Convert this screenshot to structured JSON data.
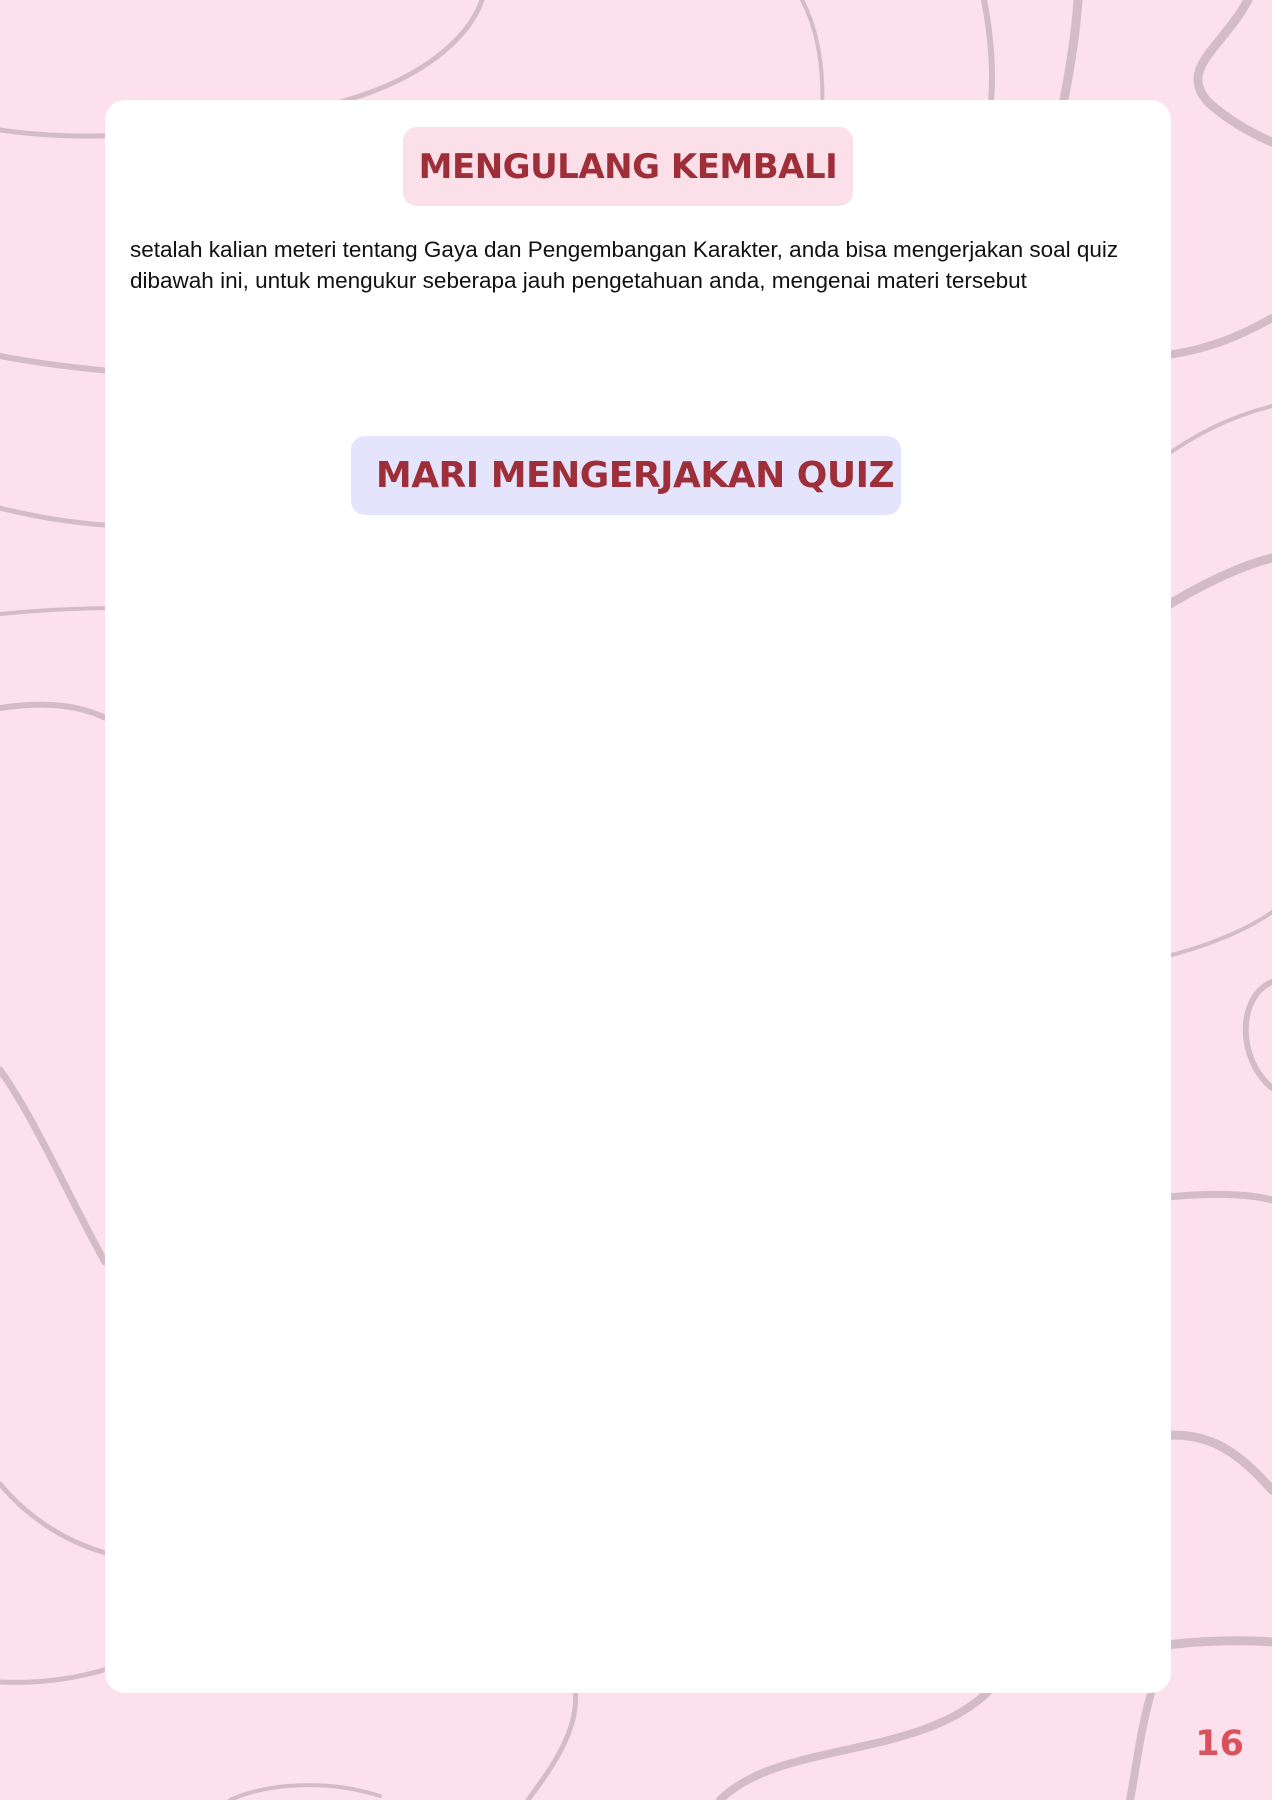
{
  "page": {
    "number": "16",
    "background_color": "#fce1ec",
    "decor_color": "#d4bcc6"
  },
  "section_review": {
    "title": "MENGULANG KEMBALI",
    "pill_color": "#fbdfe9",
    "text": "setalah kalian meteri tentang Gaya dan Pengembangan Karakter, anda bisa mengerjakan soal quiz dibawah ini, untuk mengukur seberapa jauh pengetahuan anda, mengenai materi tersebut"
  },
  "section_quiz": {
    "title": "MARI MENGERJAKAN QUIZ",
    "pill_color": "#e4e4fd"
  },
  "theme": {
    "heading_color": "#9e2f38",
    "page_number_color": "#d9515b"
  }
}
